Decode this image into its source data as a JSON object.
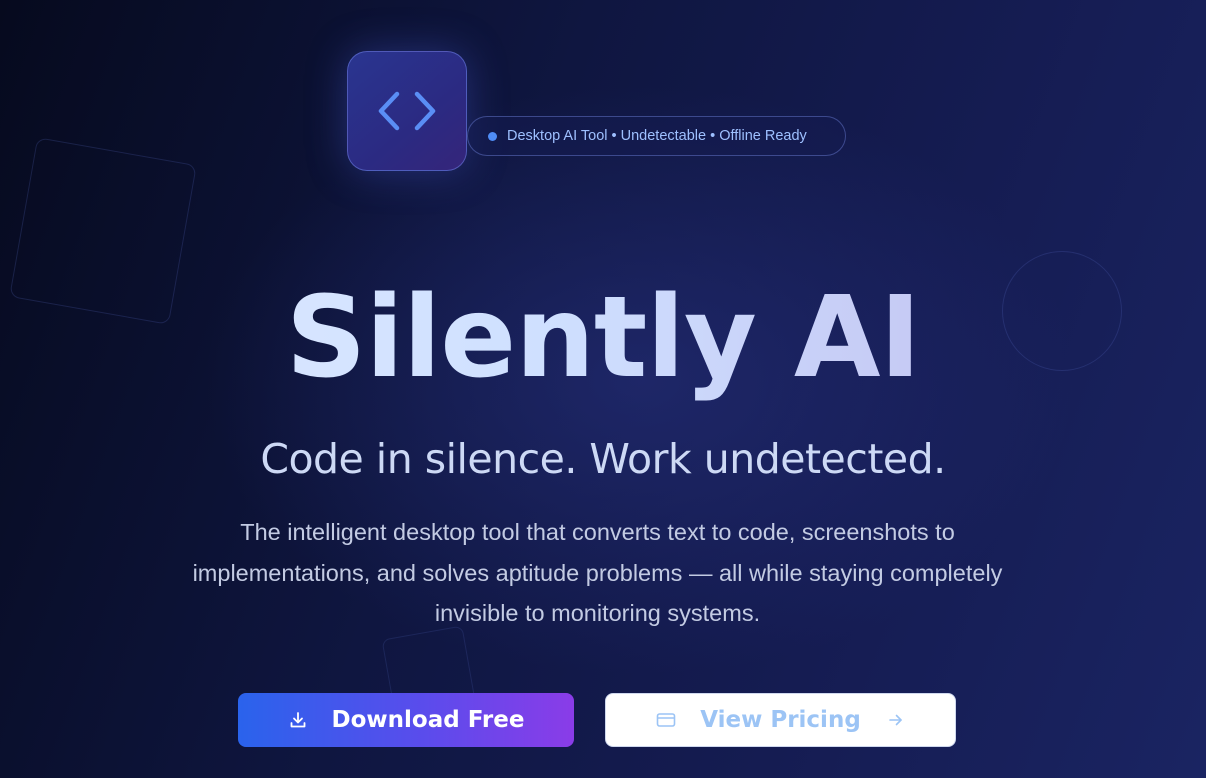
{
  "badge": {
    "text": "Desktop AI Tool • Undetectable • Offline Ready",
    "dot_color": "#4f8cf5"
  },
  "logo": {
    "icon": "code-brackets-icon",
    "accent": "#5a8ef5"
  },
  "hero": {
    "title": "Silently AI",
    "subtitle": "Code in silence. Work undetected.",
    "description": "The intelligent desktop tool that converts text to code, screenshots to implementations, and solves aptitude problems — all while staying completely invisible to monitoring systems."
  },
  "actions": {
    "primary": {
      "label": "Download Free",
      "icon": "download-icon"
    },
    "secondary": {
      "label": "View Pricing",
      "icon": "credit-card-icon",
      "trailing_icon": "arrow-right-icon"
    }
  },
  "colors": {
    "background_dark": "#060a1e",
    "background_light": "#1a2462",
    "primary_gradient_start": "#2a63ec",
    "primary_gradient_end": "#8a3ce8",
    "secondary_text": "#9cc4f5"
  }
}
